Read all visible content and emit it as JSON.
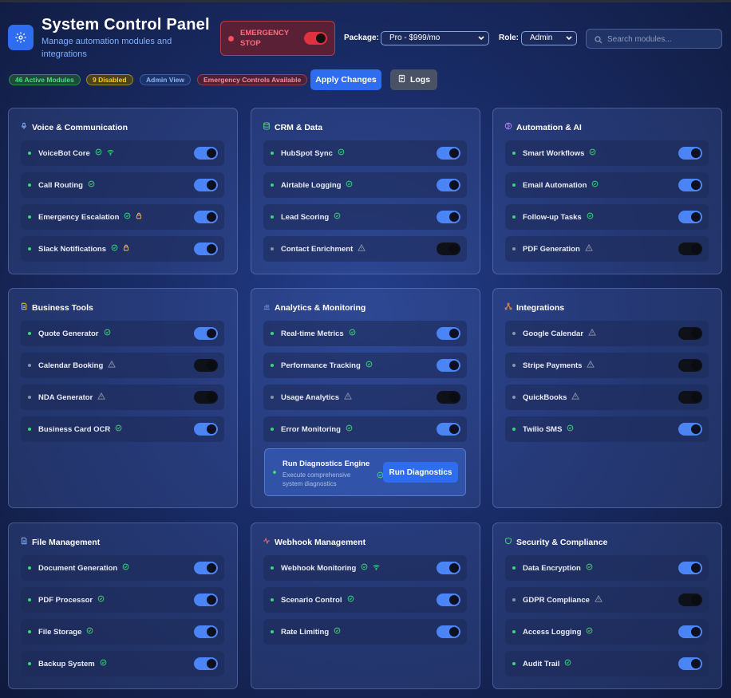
{
  "header": {
    "title": "System Control Panel",
    "subtitle": "Manage automation modules and integrations",
    "emergency_stop": "EMERGENCY STOP",
    "package_label": "Package:",
    "package_value": "Pro - $999/mo",
    "role_label": "Role:",
    "role_value": "Admin",
    "search_placeholder": "Search modules..."
  },
  "badges": {
    "active": "46 Active Modules",
    "disabled": "9 Disabled",
    "admin": "Admin View",
    "emergency": "Emergency Controls Available"
  },
  "actions": {
    "apply": "Apply Changes",
    "logs": "Logs"
  },
  "colors": {
    "accent": "#2f6df0",
    "ok": "#38d878",
    "warn": "#f5c542",
    "danger": "#e0313f",
    "off": "#8b93a8"
  },
  "panels": [
    {
      "title": "Voice & Communication",
      "icon": "mic-icon",
      "items": [
        {
          "name": "VoiceBot Core",
          "on": true,
          "status": "ok",
          "extra": "wifi"
        },
        {
          "name": "Call Routing",
          "on": true,
          "status": "ok"
        },
        {
          "name": "Emergency Escalation",
          "on": true,
          "status": "ok",
          "extra": "lock"
        },
        {
          "name": "Slack Notifications",
          "on": true,
          "status": "ok",
          "extra": "lock"
        }
      ]
    },
    {
      "title": "CRM & Data",
      "icon": "database-icon",
      "items": [
        {
          "name": "HubSpot Sync",
          "on": true,
          "status": "ok"
        },
        {
          "name": "Airtable Logging",
          "on": true,
          "status": "ok"
        },
        {
          "name": "Lead Scoring",
          "on": true,
          "status": "ok"
        },
        {
          "name": "Contact Enrichment",
          "on": false,
          "status": "warn"
        }
      ]
    },
    {
      "title": "Automation & AI",
      "icon": "brain-icon",
      "items": [
        {
          "name": "Smart Workflows",
          "on": true,
          "status": "ok"
        },
        {
          "name": "Email Automation",
          "on": true,
          "status": "ok"
        },
        {
          "name": "Follow-up Tasks",
          "on": true,
          "status": "ok"
        },
        {
          "name": "PDF Generation",
          "on": false,
          "status": "warn"
        }
      ]
    },
    {
      "title": "Business Tools",
      "icon": "document-icon",
      "items": [
        {
          "name": "Quote Generator",
          "on": true,
          "status": "ok"
        },
        {
          "name": "Calendar Booking",
          "on": false,
          "status": "warn"
        },
        {
          "name": "NDA Generator",
          "on": false,
          "status": "warn"
        },
        {
          "name": "Business Card OCR",
          "on": true,
          "status": "ok"
        }
      ]
    },
    {
      "title": "Analytics & Monitoring",
      "icon": "bar-chart-icon",
      "items": [
        {
          "name": "Real-time Metrics",
          "on": true,
          "status": "ok"
        },
        {
          "name": "Performance Tracking",
          "on": true,
          "status": "ok"
        },
        {
          "name": "Usage Analytics",
          "on": false,
          "status": "warn"
        },
        {
          "name": "Error Monitoring",
          "on": true,
          "status": "ok"
        }
      ]
    },
    {
      "title": "Integrations",
      "icon": "network-icon",
      "items": [
        {
          "name": "Google Calendar",
          "on": false,
          "status": "warn"
        },
        {
          "name": "Stripe Payments",
          "on": false,
          "status": "warn"
        },
        {
          "name": "QuickBooks",
          "on": false,
          "status": "warn"
        },
        {
          "name": "Twilio SMS",
          "on": true,
          "status": "ok"
        }
      ]
    },
    {
      "title": "File Management",
      "icon": "file-icon",
      "items": [
        {
          "name": "Document Generation",
          "on": true,
          "status": "ok"
        },
        {
          "name": "PDF Processor",
          "on": true,
          "status": "ok"
        },
        {
          "name": "File Storage",
          "on": true,
          "status": "ok"
        },
        {
          "name": "Backup System",
          "on": true,
          "status": "ok"
        }
      ]
    },
    {
      "title": "Webhook Management",
      "icon": "activity-icon",
      "items": [
        {
          "name": "Webhook Monitoring",
          "on": true,
          "status": "ok",
          "extra": "wifi"
        },
        {
          "name": "Scenario Control",
          "on": true,
          "status": "ok"
        },
        {
          "name": "Rate Limiting",
          "on": true,
          "status": "ok"
        }
      ]
    },
    {
      "title": "Security & Compliance",
      "icon": "shield-icon",
      "items": [
        {
          "name": "Data Encryption",
          "on": true,
          "status": "ok"
        },
        {
          "name": "GDPR Compliance",
          "on": false,
          "status": "warn"
        },
        {
          "name": "Access Logging",
          "on": true,
          "status": "ok"
        },
        {
          "name": "Audit Trail",
          "on": true,
          "status": "ok"
        }
      ]
    }
  ],
  "diagnostics": {
    "title": "Run Diagnostics Engine",
    "description": "Execute comprehensive system diagnostics",
    "button": "Run Diagnostics"
  }
}
